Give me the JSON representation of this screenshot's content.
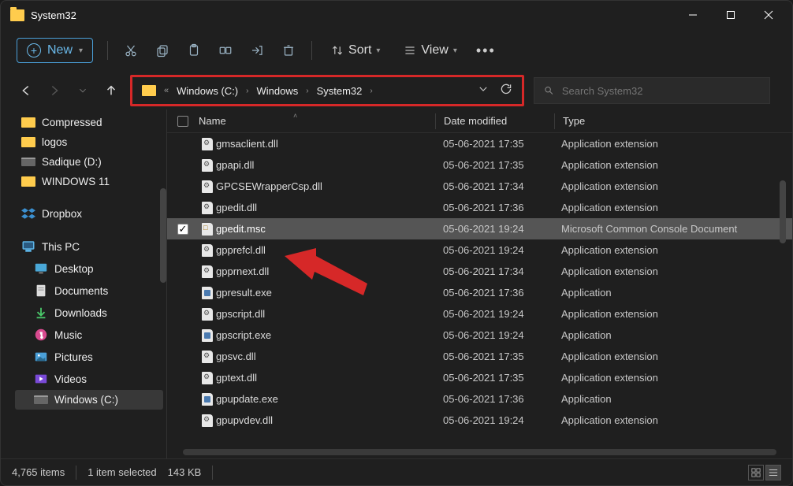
{
  "window_title": "System32",
  "toolbar": {
    "new_label": "New",
    "sort_label": "Sort",
    "view_label": "View"
  },
  "breadcrumb": {
    "items": [
      "Windows (C:)",
      "Windows",
      "System32"
    ]
  },
  "search": {
    "placeholder": "Search System32"
  },
  "sidebar": {
    "items": [
      {
        "label": "Compressed",
        "kind": "folder"
      },
      {
        "label": "logos",
        "kind": "folder"
      },
      {
        "label": "Sadique (D:)",
        "kind": "drive"
      },
      {
        "label": "WINDOWS 11",
        "kind": "folder"
      },
      {
        "label": "Dropbox",
        "kind": "dropbox"
      },
      {
        "label": "This PC",
        "kind": "pc"
      },
      {
        "label": "Desktop",
        "kind": "desktop"
      },
      {
        "label": "Documents",
        "kind": "documents"
      },
      {
        "label": "Downloads",
        "kind": "downloads"
      },
      {
        "label": "Music",
        "kind": "music"
      },
      {
        "label": "Pictures",
        "kind": "pictures"
      },
      {
        "label": "Videos",
        "kind": "videos"
      },
      {
        "label": "Windows (C:)",
        "kind": "drive"
      }
    ]
  },
  "columns": {
    "name": "Name",
    "date": "Date modified",
    "type": "Type"
  },
  "files": [
    {
      "name": "gmsaclient.dll",
      "date": "05-06-2021 17:35",
      "type": "Application extension",
      "icon": "gear",
      "selected": false
    },
    {
      "name": "gpapi.dll",
      "date": "05-06-2021 17:35",
      "type": "Application extension",
      "icon": "gear",
      "selected": false
    },
    {
      "name": "GPCSEWrapperCsp.dll",
      "date": "05-06-2021 17:34",
      "type": "Application extension",
      "icon": "gear",
      "selected": false
    },
    {
      "name": "gpedit.dll",
      "date": "05-06-2021 17:36",
      "type": "Application extension",
      "icon": "gear",
      "selected": false
    },
    {
      "name": "gpedit.msc",
      "date": "05-06-2021 19:24",
      "type": "Microsoft Common Console Document",
      "icon": "msc",
      "selected": true
    },
    {
      "name": "gpprefcl.dll",
      "date": "05-06-2021 19:24",
      "type": "Application extension",
      "icon": "gear",
      "selected": false
    },
    {
      "name": "gpprnext.dll",
      "date": "05-06-2021 17:34",
      "type": "Application extension",
      "icon": "gear",
      "selected": false
    },
    {
      "name": "gpresult.exe",
      "date": "05-06-2021 17:36",
      "type": "Application",
      "icon": "box",
      "selected": false
    },
    {
      "name": "gpscript.dll",
      "date": "05-06-2021 19:24",
      "type": "Application extension",
      "icon": "gear",
      "selected": false
    },
    {
      "name": "gpscript.exe",
      "date": "05-06-2021 19:24",
      "type": "Application",
      "icon": "box",
      "selected": false
    },
    {
      "name": "gpsvc.dll",
      "date": "05-06-2021 17:35",
      "type": "Application extension",
      "icon": "gear",
      "selected": false
    },
    {
      "name": "gptext.dll",
      "date": "05-06-2021 17:35",
      "type": "Application extension",
      "icon": "gear",
      "selected": false
    },
    {
      "name": "gpupdate.exe",
      "date": "05-06-2021 17:36",
      "type": "Application",
      "icon": "box",
      "selected": false
    },
    {
      "name": "gpupvdev.dll",
      "date": "05-06-2021 19:24",
      "type": "Application extension",
      "icon": "gear",
      "selected": false
    }
  ],
  "status": {
    "item_count": "4,765 items",
    "selection": "1 item selected",
    "size": "143 KB"
  }
}
